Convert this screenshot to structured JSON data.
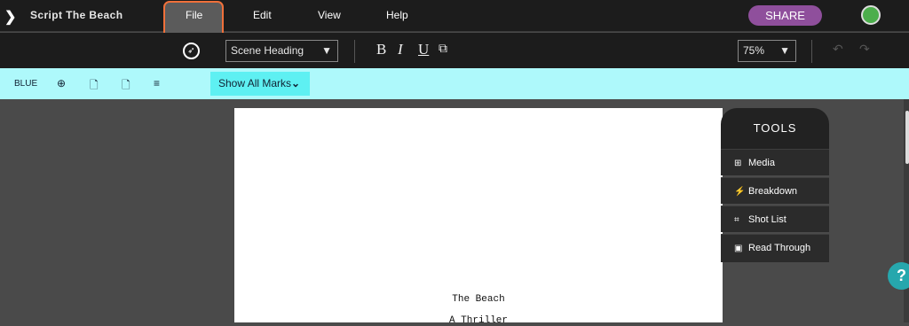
{
  "app": {
    "title": "Script The Beach"
  },
  "menu": {
    "file": "File",
    "edit": "Edit",
    "view": "View",
    "help": "Help"
  },
  "share_label": "SHARE",
  "toolbar": {
    "element_select": "Scene Heading",
    "bold": "B",
    "italic": "I",
    "underline": "U",
    "zoom": "75%"
  },
  "marks": {
    "revision_color": "BLUE",
    "show_marks": "Show All Marks"
  },
  "tools": {
    "header": "TOOLS",
    "items": [
      {
        "label": "Media",
        "icon": "media-icon"
      },
      {
        "label": "Breakdown",
        "icon": "magic-wand-icon"
      },
      {
        "label": "Shot List",
        "icon": "shot-list-icon"
      },
      {
        "label": "Read Through",
        "icon": "read-through-icon"
      }
    ]
  },
  "script": {
    "title": "The Beach",
    "subtitle": "A Thriller"
  },
  "help_label": "?",
  "colors": {
    "accent": "#8f4f9c",
    "marks_bar": "#aef9fb",
    "status": "#4cae4c"
  }
}
